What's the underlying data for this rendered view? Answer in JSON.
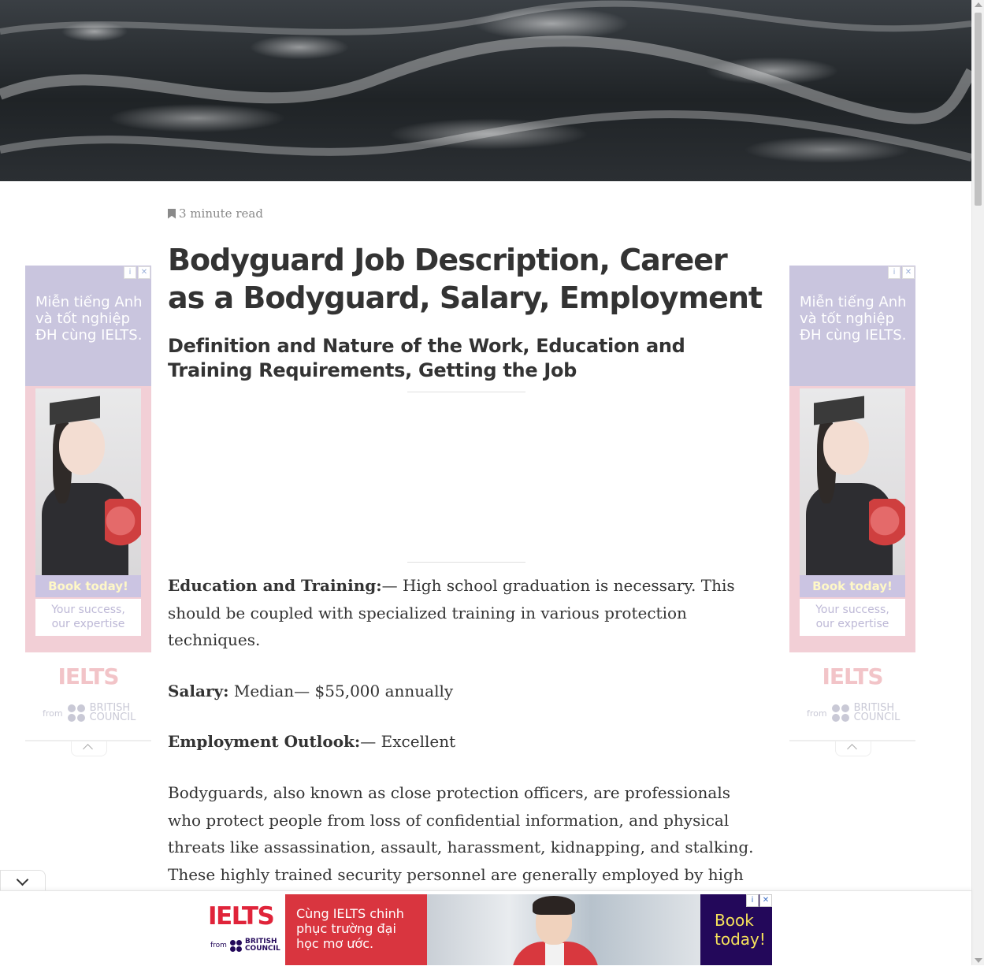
{
  "article": {
    "read_time": "3 minute read",
    "title": "Bodyguard Job Description, Career as a Bodyguard, Salary, Employment",
    "subtitle": "Definition and Nature of the Work, Education and Training Requirements, Getting the Job",
    "education_label": "Education and Training:",
    "education_text": "— High school graduation is necessary. This should be coupled with specialized training in various protection techniques.",
    "salary_label": "Salary:",
    "salary_text": " Median— $55,000 annually",
    "outlook_label": "Employment Outlook:",
    "outlook_text": "— Excellent",
    "body_paragraph": "Bodyguards, also known as close protection officers, are professionals who protect people from loss of confidential information, and physical threats like assassination, assault, harassment, kidnapping, and stalking. These highly trained security personnel are generally employed by high profile"
  },
  "side_ad": {
    "headline": "Miễn tiếng Anh và tốt nghiệp ĐH cùng IELTS.",
    "book_label": "Book today!",
    "success_line1": "Your success,",
    "success_line2": "our expertise",
    "brand": "IELTS",
    "from": "from",
    "council_line1": "BRITISH",
    "council_line2": "COUNCIL",
    "adchoice_info": "i",
    "adchoice_close": "✕"
  },
  "bottom_ad": {
    "brand": "IELTS",
    "from": "from",
    "council_line1": "BRITISH",
    "council_line2": "COUNCIL",
    "tagline": "Cùng IELTS chinh phục trường đại học mơ ước.",
    "book_label": "Book today!",
    "adchoice_info": "i",
    "adchoice_close": "✕"
  },
  "colors": {
    "ad_lavender": "#c9c5de",
    "ad_pink": "#f2cfd6",
    "banner_red": "#d9353f",
    "banner_purple": "#23085a",
    "ielts_red": "#e0243a"
  }
}
